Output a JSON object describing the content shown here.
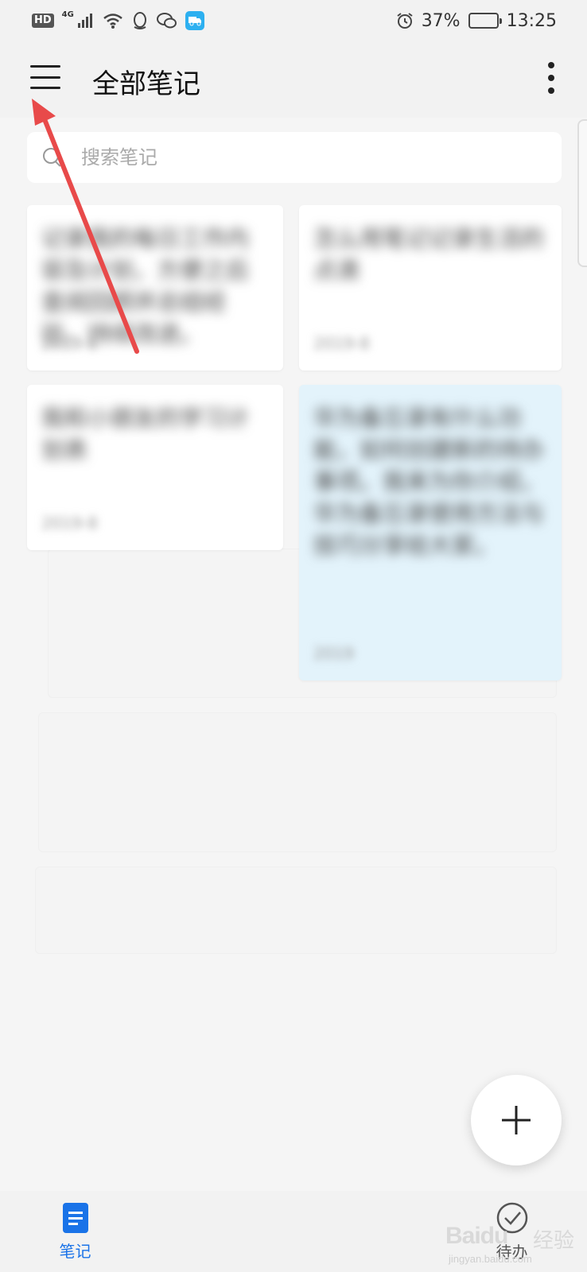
{
  "status_bar": {
    "hd": "HD",
    "network": "4G",
    "alarm_icon": "alarm-clock-icon",
    "battery_percent": "37%",
    "battery_level": 0.37,
    "time": "13:25"
  },
  "header": {
    "title": "全部笔记",
    "menu_icon": "hamburger-menu-icon",
    "more_icon": "more-vertical-icon"
  },
  "search": {
    "placeholder": "搜索笔记"
  },
  "notes": [
    {
      "text": "记录我的每日工作内容及计划，方便之后查阅回顾并总结经验，持续改进。",
      "date": "2019-8"
    },
    {
      "text": "怎么用笔记记录生活的点滴",
      "date": "2019-8"
    },
    {
      "text": "我和小朋友的学习计划表",
      "date": "2019-8"
    },
    {
      "text": "华为备忘录有什么功能，如何创建新的待办事项。我来为你介绍，华为备忘录使用方法与技巧分享给大家。",
      "date": "2019"
    }
  ],
  "accent_color": "#1a73e8",
  "annotation_color": "#e84a4a",
  "fab": {
    "icon": "plus-icon"
  },
  "bottom_nav": {
    "tabs": [
      {
        "label": "笔记",
        "icon": "notes-icon",
        "active": true
      },
      {
        "label": "待办",
        "icon": "check-circle-icon",
        "active": false
      }
    ]
  },
  "watermark": {
    "brand": "Baidu",
    "suffix": "经验",
    "url": "jingyan.baidu.com"
  }
}
